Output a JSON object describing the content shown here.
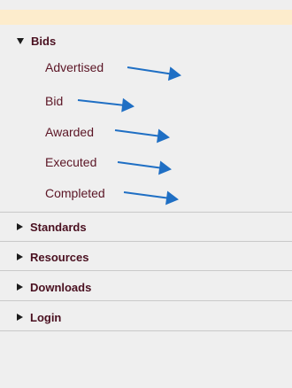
{
  "colors": {
    "panel_bg": "#efefef",
    "top_bar": "#fdeccc",
    "link_text": "#5b1525",
    "annotation_arrow": "#1f6fc4"
  },
  "menu": {
    "bids": {
      "label": "Bids",
      "expanded": true,
      "icon": "caret-down-icon",
      "items": [
        {
          "label": "Advertised"
        },
        {
          "label": "Bid"
        },
        {
          "label": "Awarded"
        },
        {
          "label": "Executed"
        },
        {
          "label": "Completed"
        }
      ]
    },
    "standards": {
      "label": "Standards",
      "expanded": false,
      "icon": "caret-right-icon"
    },
    "resources": {
      "label": "Resources",
      "expanded": false,
      "icon": "caret-right-icon"
    },
    "downloads": {
      "label": "Downloads",
      "expanded": false,
      "icon": "caret-right-icon"
    },
    "login": {
      "label": "Login",
      "expanded": false,
      "icon": "caret-right-icon"
    }
  }
}
